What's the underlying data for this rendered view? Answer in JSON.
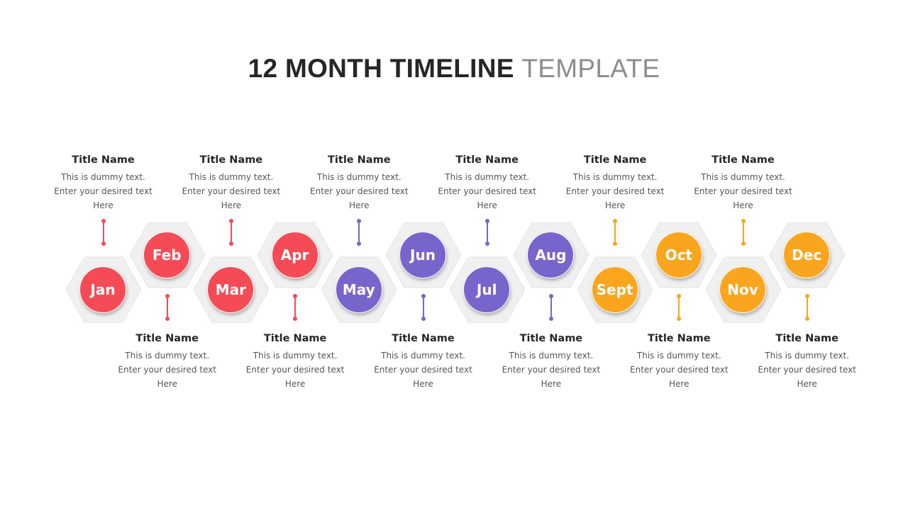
{
  "header": {
    "title_bold": "12 MONTH TIMELINE",
    "title_light": "TEMPLATE"
  },
  "colors": {
    "red": "#F44B57",
    "purple": "#7865CB",
    "orange": "#F9A61E",
    "hex_fill": "#F0F0F0",
    "title_dark": "#262626",
    "title_light": "#8C8C8C"
  },
  "months": [
    {
      "label": "Jan",
      "color": "#F44B57",
      "row": "low",
      "title": "Title Name",
      "lines": [
        "This is dummy text.",
        "Enter your desired text",
        "Here"
      ]
    },
    {
      "label": "Feb",
      "color": "#F44B57",
      "row": "high",
      "title": "Title Name",
      "lines": [
        "This is dummy text.",
        "Enter your desired text",
        "Here"
      ]
    },
    {
      "label": "Mar",
      "color": "#F44B57",
      "row": "low",
      "title": "Title Name",
      "lines": [
        "This is dummy text.",
        "Enter your desired text",
        "Here"
      ]
    },
    {
      "label": "Apr",
      "color": "#F44B57",
      "row": "high",
      "title": "Title Name",
      "lines": [
        "This is dummy text.",
        "Enter your desired text",
        "Here"
      ]
    },
    {
      "label": "May",
      "color": "#7865CB",
      "row": "low",
      "title": "Title Name",
      "lines": [
        "This is dummy text.",
        "Enter your desired text",
        "Here"
      ]
    },
    {
      "label": "Jun",
      "color": "#7865CB",
      "row": "high",
      "title": "Title Name",
      "lines": [
        "This is dummy text.",
        "Enter your desired text",
        "Here"
      ]
    },
    {
      "label": "Jul",
      "color": "#7865CB",
      "row": "low",
      "title": "Title Name",
      "lines": [
        "This is dummy text.",
        "Enter your desired text",
        "Here"
      ]
    },
    {
      "label": "Aug",
      "color": "#7865CB",
      "row": "high",
      "title": "Title Name",
      "lines": [
        "This is dummy text.",
        "Enter your desired text",
        "Here"
      ]
    },
    {
      "label": "Sept",
      "color": "#F9A61E",
      "row": "low",
      "title": "Title Name",
      "lines": [
        "This is dummy text.",
        "Enter your desired text",
        "Here"
      ]
    },
    {
      "label": "Oct",
      "color": "#F9A61E",
      "row": "high",
      "title": "Title Name",
      "lines": [
        "This is dummy text.",
        "Enter your desired text",
        "Here"
      ]
    },
    {
      "label": "Nov",
      "color": "#F9A61E",
      "row": "low",
      "title": "Title Name",
      "lines": [
        "This is dummy text.",
        "Enter your desired text",
        "Here"
      ]
    },
    {
      "label": "Dec",
      "color": "#F9A61E",
      "row": "high",
      "title": "Title Name",
      "lines": [
        "This is dummy text.",
        "Enter your desired text",
        "Here"
      ]
    }
  ]
}
